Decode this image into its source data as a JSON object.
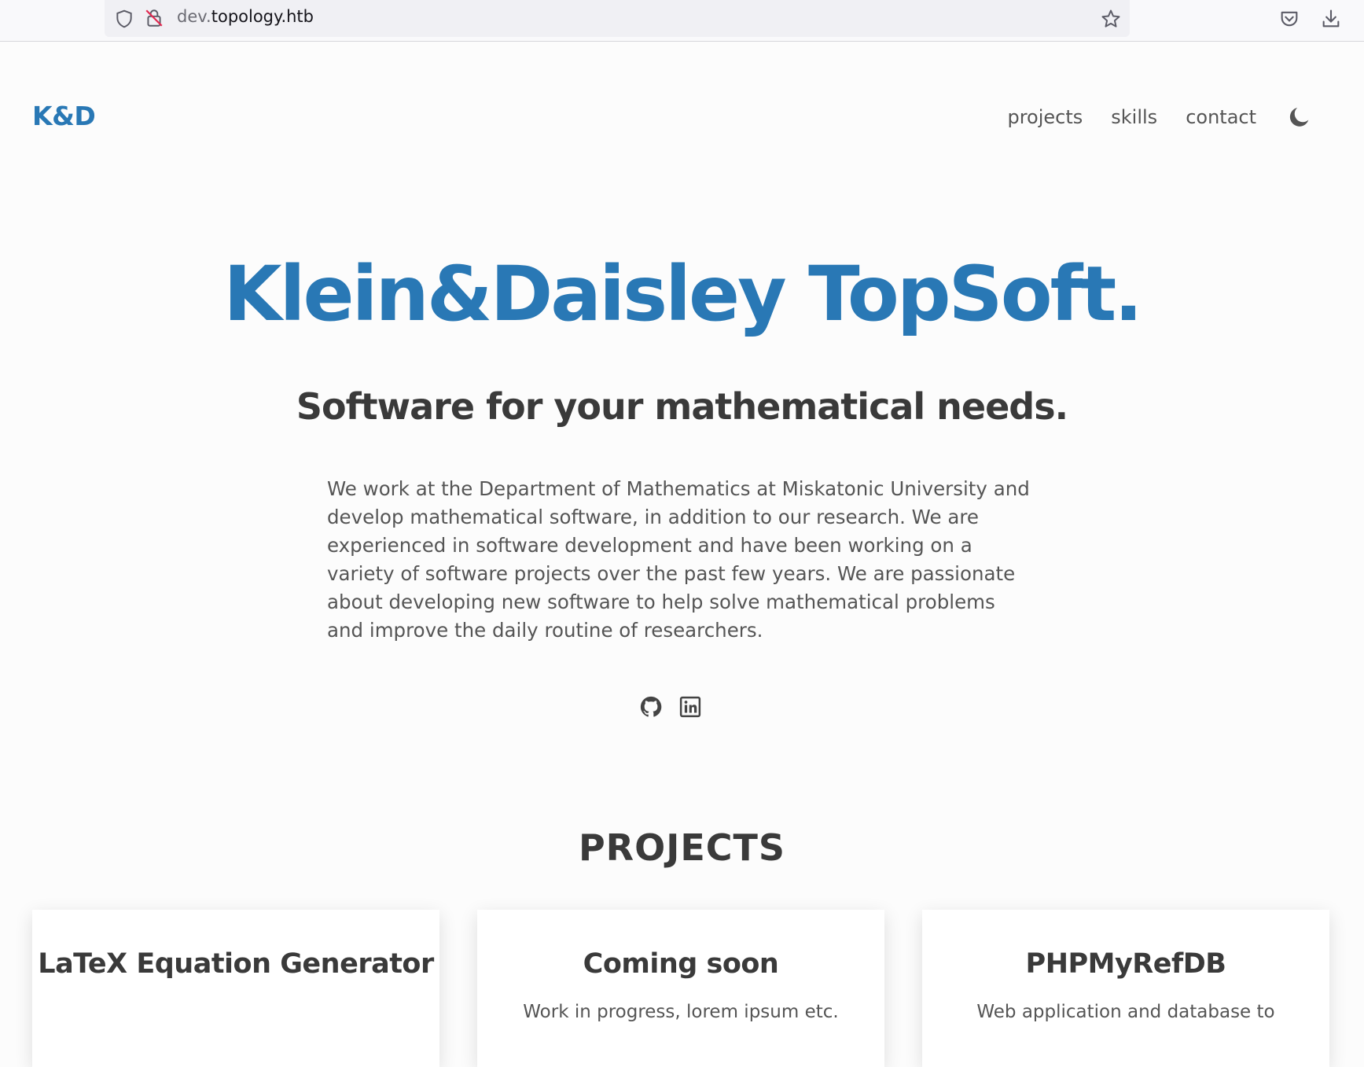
{
  "browser": {
    "url_prefix": "dev.",
    "url_domain": "topology.htb",
    "icons": {
      "shield": "shield-icon",
      "lock": "insecure-lock-icon",
      "bookmark": "star-icon",
      "pocket": "pocket-icon",
      "downloads": "download-icon"
    }
  },
  "header": {
    "logo": "K&D",
    "nav": [
      {
        "label": "projects"
      },
      {
        "label": "skills"
      },
      {
        "label": "contact"
      }
    ],
    "theme_toggle_icon": "moon-icon"
  },
  "hero": {
    "title": "Klein&Daisley TopSoft.",
    "subtitle": "Software for your mathematical needs.",
    "about": "We work at the Department of Mathematics at Miskatonic University and develop mathematical software, in addition to our research. We are experienced in software development and have been working on a variety of software projects over the past few years. We are passionate about developing new software to help solve mathematical problems and improve the daily routine of researchers.",
    "social": [
      "github-icon",
      "linkedin-icon"
    ]
  },
  "projects": {
    "heading": "PROJECTS",
    "cards": [
      {
        "title": "LaTeX Equation Generator",
        "desc": ""
      },
      {
        "title": "Coming soon",
        "desc": "Work in progress, lorem ipsum etc."
      },
      {
        "title": "PHPMyRefDB",
        "desc": "Web application and database to"
      }
    ]
  },
  "colors": {
    "accent": "#2978b5",
    "heading": "#3a3a3a",
    "text": "#555555",
    "background": "#fcfcfc"
  }
}
